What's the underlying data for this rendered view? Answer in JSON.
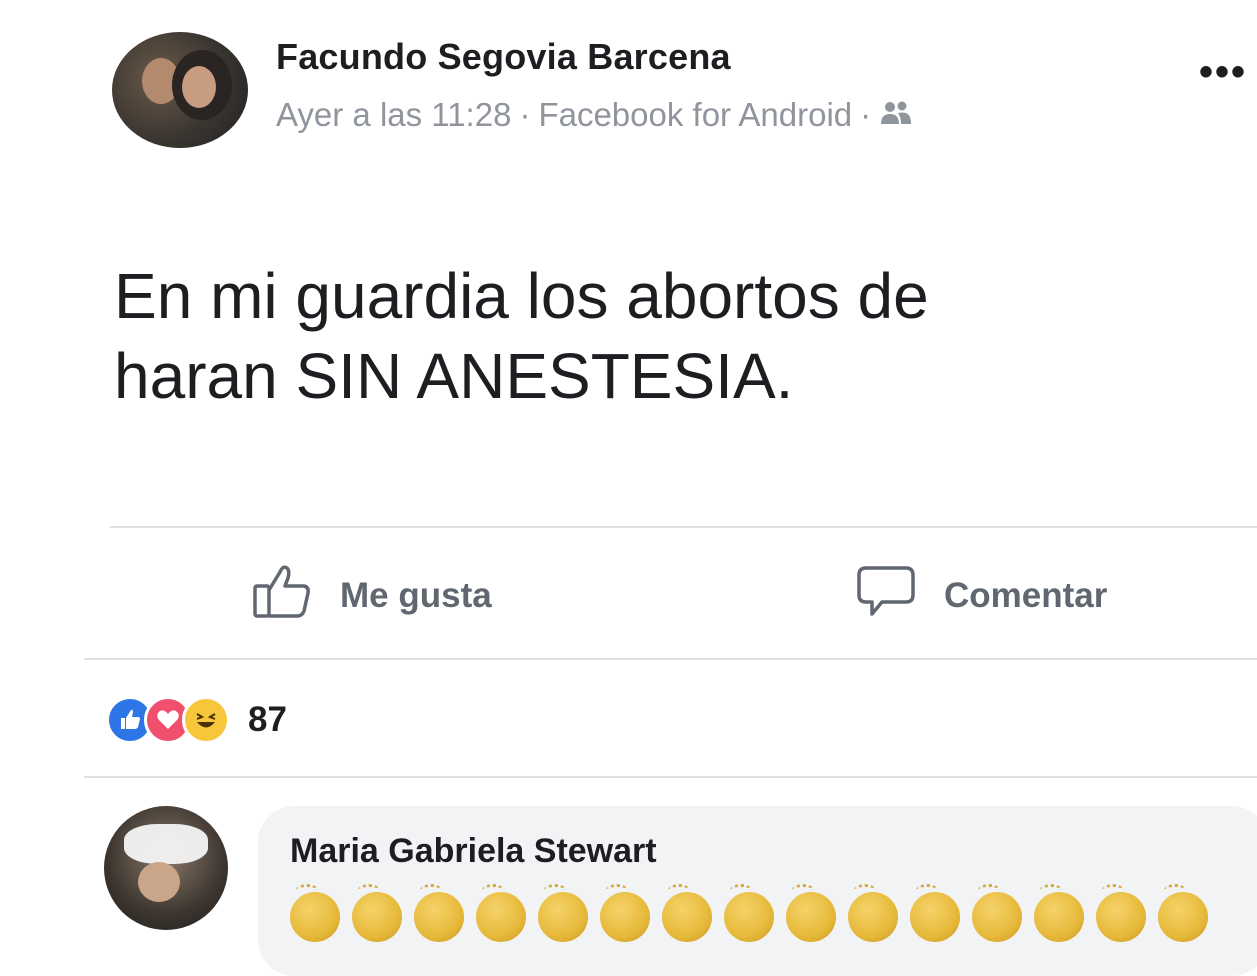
{
  "post": {
    "author": "Facundo Segovia Barcena",
    "time": "Ayer a las 11:28",
    "separator": "·",
    "source": "Facebook for Android",
    "audience_icon": "friends-icon",
    "more_label": "•••",
    "text_line1": "En mi guardia los abortos de",
    "text_line2": "haran SIN ANESTESIA."
  },
  "actions": {
    "like_label": "Me gusta",
    "comment_label": "Comentar"
  },
  "reactions": {
    "icons": [
      "like-reaction-icon",
      "love-reaction-icon",
      "haha-reaction-icon"
    ],
    "count": "87"
  },
  "comment": {
    "author": "Maria Gabriela Stewart",
    "emoji": "clapping-hands",
    "emoji_count": 15
  },
  "colors": {
    "meta_gray": "#90949c",
    "divider": "#dddfe2",
    "like_blue": "#2e76e6",
    "love_red": "#f0506e",
    "haha_yellow": "#f7c63b",
    "bubble": "#f2f3f5"
  }
}
